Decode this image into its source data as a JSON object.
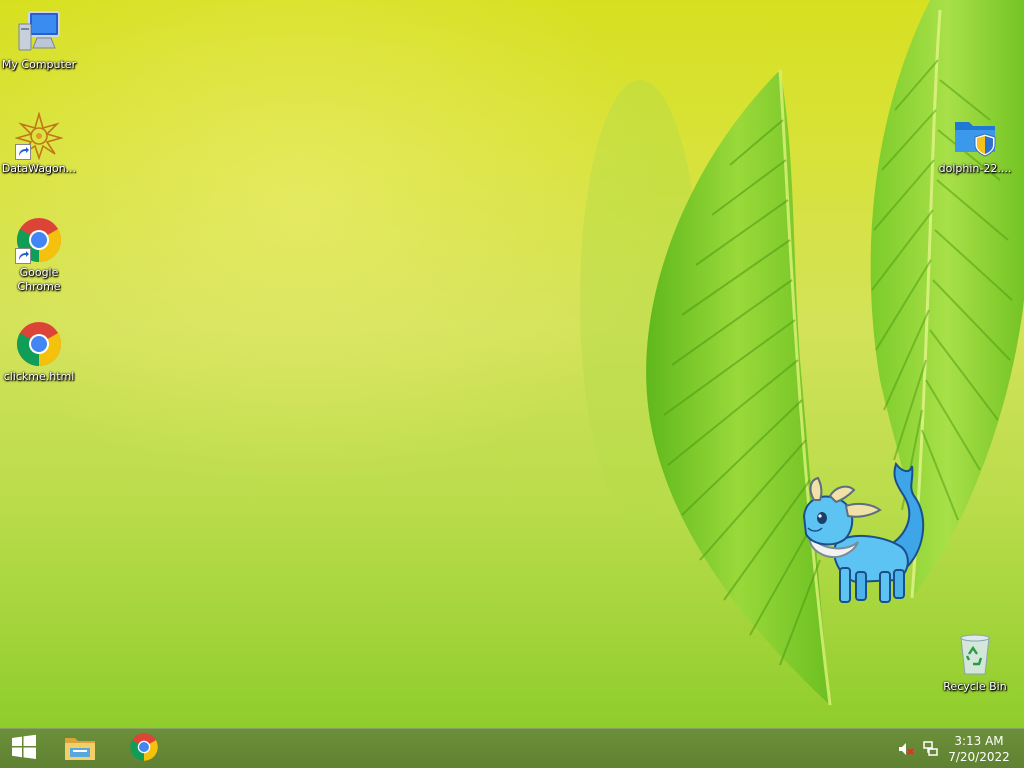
{
  "desktop": {
    "icons_left": [
      {
        "label": "My Computer",
        "icon": "computer-icon"
      },
      {
        "label": "DataWagon...",
        "icon": "datawagon-icon"
      },
      {
        "label": "Google Chrome",
        "icon": "chrome-icon"
      },
      {
        "label": "clickme.html",
        "icon": "chrome-icon"
      }
    ],
    "icons_right": [
      {
        "label": "dolphin-22....",
        "icon": "folder-shield-icon"
      },
      {
        "label": "Recycle Bin",
        "icon": "recycle-bin-icon"
      }
    ],
    "mascot": "vaporeon-sprite-icon"
  },
  "taskbar": {
    "start": "windows-start-icon",
    "pinned": [
      {
        "name": "file-explorer",
        "icon": "file-explorer-icon"
      },
      {
        "name": "chrome",
        "icon": "chrome-icon"
      }
    ],
    "tray": {
      "volume": "volume-muted-icon",
      "network": "network-icon",
      "time": "3:13 AM",
      "date": "7/20/2022"
    }
  },
  "colors": {
    "taskbar": "#648838",
    "wallpaper_top": "#d7e020",
    "wallpaper_bottom": "#8fcd2c",
    "leaf": "#7cc92a"
  }
}
